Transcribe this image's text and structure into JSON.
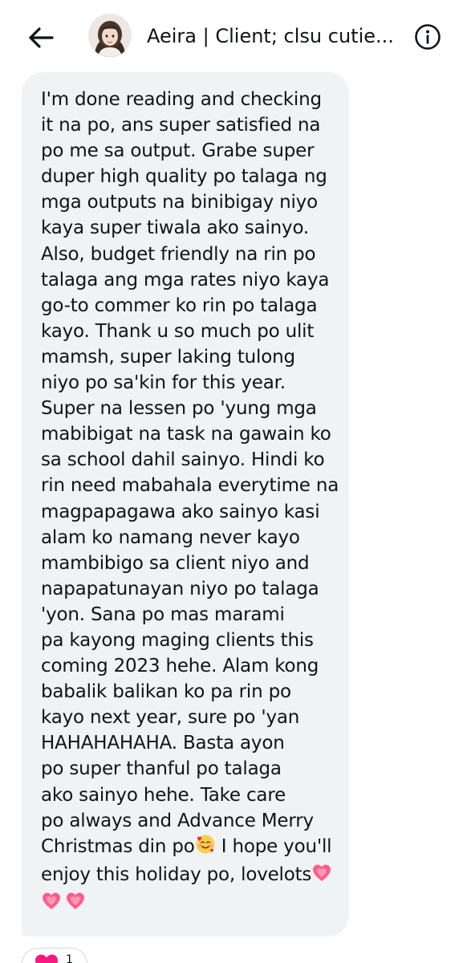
{
  "header": {
    "title": "Aeira | Client; clsu cutie..."
  },
  "icons": {
    "back": "arrow-left-icon",
    "info": "info-circle-icon",
    "heart": "heart-emoji",
    "smiling_face_hearts": "smiling-face-with-hearts-emoji",
    "reaction": "heart-reaction-icon"
  },
  "message": {
    "lines": [
      "I'm done reading and checking",
      "it na po, ans super satisfied na",
      "po me sa output. Grabe super",
      "duper high quality po talaga ng",
      "mga outputs na binibigay niyo",
      "kaya super tiwala ako sainyo.",
      "Also, budget friendly na rin po",
      "talaga ang mga rates niyo kaya",
      "go-to commer ko rin po talaga",
      "kayo. Thank u so much po ulit",
      "mamsh, super laking tulong",
      "niyo po sa'kin for this year.",
      "Super na lessen po 'yung mga",
      "mabibigat na task na gawain ko",
      "sa school dahil sainyo. Hindi ko",
      "rin need mabahala everytime na",
      "magpapagawa ako sainyo kasi",
      "alam ko namang never kayo",
      "mambibigo sa client niyo and",
      "napapatunayan niyo po talaga",
      "'yon. Sana po mas marami",
      "pa kayong maging clients this",
      "coming 2023 hehe. Alam kong",
      "babalik balikan ko pa rin po",
      "kayo next year, sure po 'yan",
      "HAHAHAHAHA. Basta ayon",
      "po super thanful po talaga",
      "ako sainyo hehe. Take care",
      "po always and Advance Merry"
    ],
    "line30_before": "Christmas din po",
    "line30_after": " I hope you'll",
    "line31": "enjoy this holiday po, lovelots"
  },
  "reaction": {
    "count": "1"
  },
  "colors": {
    "bubble_bg": "#eff3f4",
    "text": "#0f1419",
    "heart": "#f91880",
    "heart_emoji": "#ff5c8a"
  }
}
